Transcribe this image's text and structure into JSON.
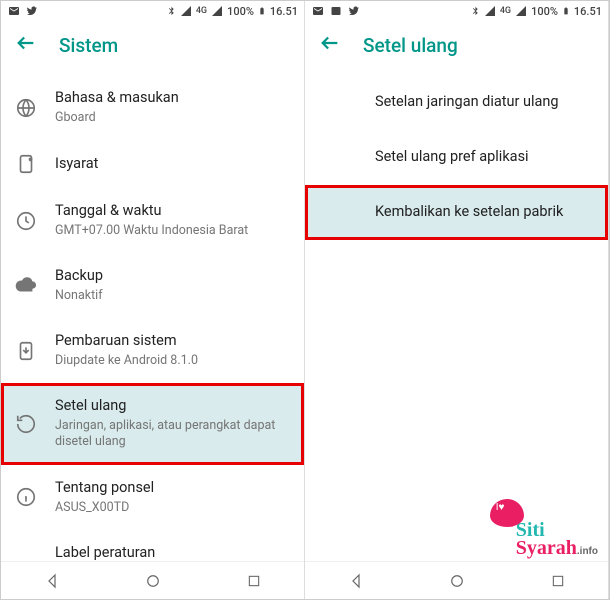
{
  "status": {
    "battery_pct": "100%",
    "time": "16.51",
    "net": "4G"
  },
  "left": {
    "header": "Sistem",
    "items": [
      {
        "icon": "globe",
        "title": "Bahasa & masukan",
        "sub": "Gboard"
      },
      {
        "icon": "gesture",
        "title": "Isyarat",
        "sub": ""
      },
      {
        "icon": "clock",
        "title": "Tanggal & waktu",
        "sub": "GMT+07.00 Waktu Indonesia Barat"
      },
      {
        "icon": "cloud",
        "title": "Backup",
        "sub": "Nonaktif"
      },
      {
        "icon": "update",
        "title": "Pembaruan sistem",
        "sub": "Diupdate ke Android 8.1.0"
      },
      {
        "icon": "reset",
        "title": "Setel ulang",
        "sub": "Jaringan, aplikasi, atau perangkat dapat disetel ulang",
        "highlight": true
      },
      {
        "icon": "info",
        "title": "Tentang ponsel",
        "sub": "ASUS_X00TD"
      },
      {
        "icon": "",
        "title": "Label peraturan",
        "sub": ""
      }
    ]
  },
  "right": {
    "header": "Setel ulang",
    "items": [
      {
        "title": "Setelan jaringan diatur ulang"
      },
      {
        "title": "Setel ulang pref aplikasi"
      },
      {
        "title": "Kembalikan ke setelan pabrik",
        "highlight": true
      }
    ]
  },
  "watermark": {
    "line1": "Siti",
    "line2": "Syarah",
    "line3": ".info",
    "bubble": "I♥"
  }
}
